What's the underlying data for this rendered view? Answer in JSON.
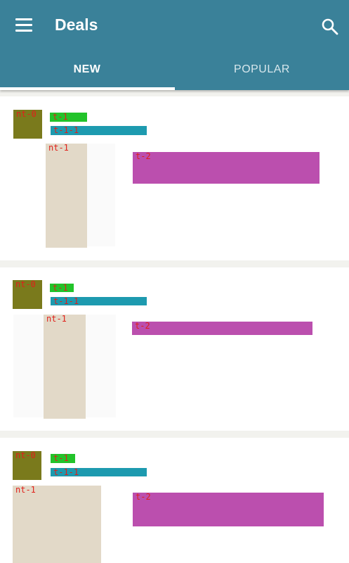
{
  "header": {
    "title": "Deals",
    "menu_icon": "hamburger-menu-icon",
    "search_icon": "search-icon"
  },
  "tabs": [
    {
      "label": "NEW",
      "selected": true
    },
    {
      "label": "POPULAR",
      "selected": false
    }
  ],
  "colors": {
    "appbar": "#3a8199",
    "tab_selected_text": "#ffffff",
    "tab_unselected_text": "#d7e7ec",
    "background": "#f2f2ee"
  },
  "deals": [
    {
      "avatar": "nt-0",
      "title": "t-1",
      "subtitle": "t-1-1",
      "image": "nt-1",
      "description": "t-2"
    },
    {
      "avatar": "nt-0",
      "title": "t-1",
      "subtitle": "t-1-1",
      "image": "nt-1",
      "description": "t-2"
    },
    {
      "avatar": "nt-0",
      "title": "t-1",
      "subtitle": "t-1-1",
      "image": "nt-1",
      "description": "t-2"
    }
  ]
}
